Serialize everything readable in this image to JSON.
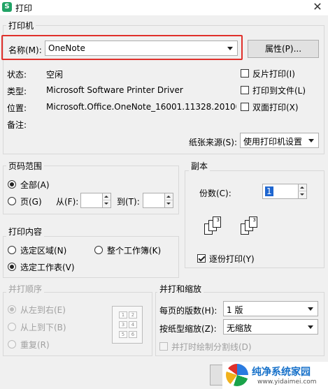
{
  "window": {
    "title": "打印",
    "app_icon": "S",
    "close": "✕"
  },
  "printer": {
    "legend": "打印机",
    "name_label": "名称(M):",
    "name_value": "OneNote",
    "properties_button": "属性(P)...",
    "status_label": "状态:",
    "status_value": "空闲",
    "type_label": "类型:",
    "type_value": "Microsoft Software Printer Driver",
    "location_label": "位置:",
    "location_value": "Microsoft.Office.OneNote_16001.11328.20100.(",
    "comment_label": "备注:",
    "reverse_print": "反片打印(I)",
    "print_to_file": "打印到文件(L)",
    "duplex": "双面打印(X)",
    "paper_source_label": "纸张来源(S):",
    "paper_source_value": "使用打印机设置"
  },
  "page_range": {
    "legend": "页码范围",
    "all": "全部(A)",
    "pages": "页(G)",
    "from_label": "从(F):",
    "to_label": "到(T):"
  },
  "copies": {
    "legend": "副本",
    "count_label": "份数(C):",
    "count_value": "1",
    "collate": "逐份打印(Y)",
    "stack_a": [
      "1",
      "2",
      "3"
    ],
    "stack_b": [
      "1",
      "2",
      "3"
    ]
  },
  "print_what": {
    "legend": "打印内容",
    "selection": "选定区域(N)",
    "workbook": "整个工作簿(K)",
    "sheet": "选定工作表(V)"
  },
  "order": {
    "legend": "并打顺序",
    "left_right": "从左到右(E)",
    "top_bottom": "从上到下(B)",
    "repeat": "重复(R)",
    "preview_cells": [
      "1",
      "2",
      "3",
      "4",
      "5",
      "6"
    ]
  },
  "zoom": {
    "legend": "并打和缩放",
    "pages_per_sheet_label": "每页的版数(H):",
    "pages_per_sheet_value": "1 版",
    "scale_label": "按纸型缩放(Z):",
    "scale_value": "无缩放",
    "draw_borders": "并打时绘制分割线(D)"
  },
  "watermark": {
    "title": "纯净系统家园",
    "url": "www.yidaimei.com"
  },
  "colors": {
    "highlight": "#e0302b",
    "accent": "#21a366"
  }
}
